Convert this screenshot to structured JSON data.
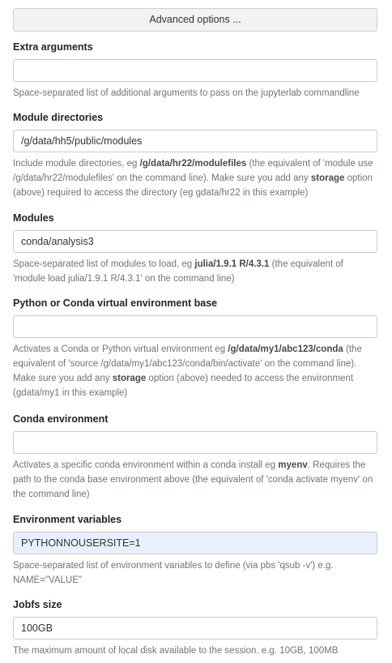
{
  "advanced_button": {
    "label": "Advanced options ..."
  },
  "extra_arguments": {
    "label": "Extra arguments",
    "value": "",
    "help": "Space-separated list of additional arguments to pass on the jupyterlab commandline"
  },
  "module_directories": {
    "label": "Module directories",
    "value": "/g/data/hh5/public/modules",
    "help": {
      "t1": "Include module directories, eg ",
      "b1": "/g/data/hr22/modulefiles",
      "t2": " (the equivalent of 'module use /g/data/hr22/modulefiles' on the command line). Make sure you add any ",
      "b2": "storage",
      "t3": " option (above) required to access the directory (eg gdata/hr22 in this example)"
    }
  },
  "modules": {
    "label": "Modules",
    "value": "conda/analysis3",
    "help": {
      "t1": "Space-separated list of modules to load, eg ",
      "b1": "julia/1.9.1 R/4.3.1",
      "t2": " (the equivalent of 'module load julia/1.9.1 R/4.3.1' on the command line)"
    }
  },
  "python_env_base": {
    "label": "Python or Conda virtual environment base",
    "value": "",
    "help": {
      "t1": "Activates a Conda or Python virtual environment eg ",
      "b1": "/g/data/my1/abc123/conda",
      "t2": " (the equivalent of 'source /g/data/my1/abc123/conda/bin/activate' on the command line). Make sure you add any ",
      "b2": "storage",
      "t3": " option (above) needed to access the environment (gdata/my1 in this example)"
    }
  },
  "conda_environment": {
    "label": "Conda environment",
    "value": "",
    "help": {
      "t1": "Activates a specific conda environment within a conda install eg ",
      "b1": "myenv",
      "t2": ". Requires the path to the conda base environment above (the equivalent of 'conda activate myenv' on the command line)"
    }
  },
  "environment_variables": {
    "label": "Environment variables",
    "value": "PYTHONNOUSERSITE=1",
    "help": "Space-separated list of environment variables to define (via pbs 'qsub -v') e.g. NAME=\"VALUE\""
  },
  "jobfs_size": {
    "label": "Jobfs size",
    "value": "100GB",
    "help": "The maximum amount of local disk available to the session. e.g. 10GB, 100MB"
  }
}
